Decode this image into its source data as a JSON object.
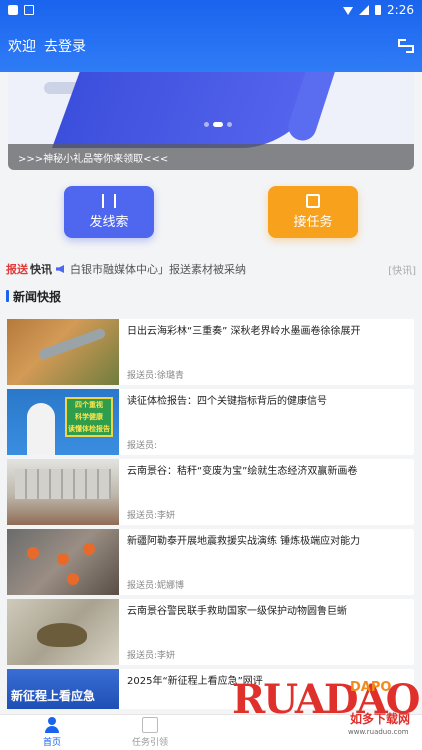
{
  "status": {
    "time": "2:26"
  },
  "header": {
    "welcome": "欢迎",
    "login": "去登录"
  },
  "banner": {
    "caption": ">>>神秘小礼品等你来领取<<<"
  },
  "actions": {
    "clue_label": "发线索",
    "task_label": "接任务"
  },
  "ticker": {
    "brand_red": "报送",
    "brand_dark": "快讯",
    "text": "白银市融媒体中心」报送素材被采纳",
    "tag": "[快讯]"
  },
  "section": {
    "title": "新闻快报"
  },
  "news": [
    {
      "title": "日出云海彩林“三重奏” 深秋老界岭水墨画卷徐徐展开",
      "reporter": "报送员:徐璐青"
    },
    {
      "title": "读征体检报告：四个关键指标背后的健康信号",
      "reporter": "报送员:",
      "thumb_text": [
        "四个重视",
        "科学健康",
        "读懂体检报告"
      ]
    },
    {
      "title": "云南景谷：秸秆“变废为宝”绘就生态经济双赢新画卷",
      "reporter": "报送员:李妍"
    },
    {
      "title": "新疆阿勒泰开展地震救援实战演练 锤炼极端应对能力",
      "reporter": "报送员:妮娜博"
    },
    {
      "title": "云南景谷警民联手救助国家一级保护动物圆鲁巨蜥",
      "reporter": "报送员:李妍"
    },
    {
      "title": "2025年“新征程上看应急”网评",
      "reporter": "",
      "thumb_text": "新征程上看应急"
    }
  ],
  "nav": {
    "home": "首页",
    "tasks": "任务引领"
  },
  "watermark": {
    "brand": "RUADAO",
    "small": "DAPO",
    "cn": "如多下载网",
    "url": "www.ruaduo.com"
  },
  "colors": {
    "primary": "#1a63ee",
    "accent_orange": "#f7a11d",
    "button_blue": "#4f67ef"
  }
}
